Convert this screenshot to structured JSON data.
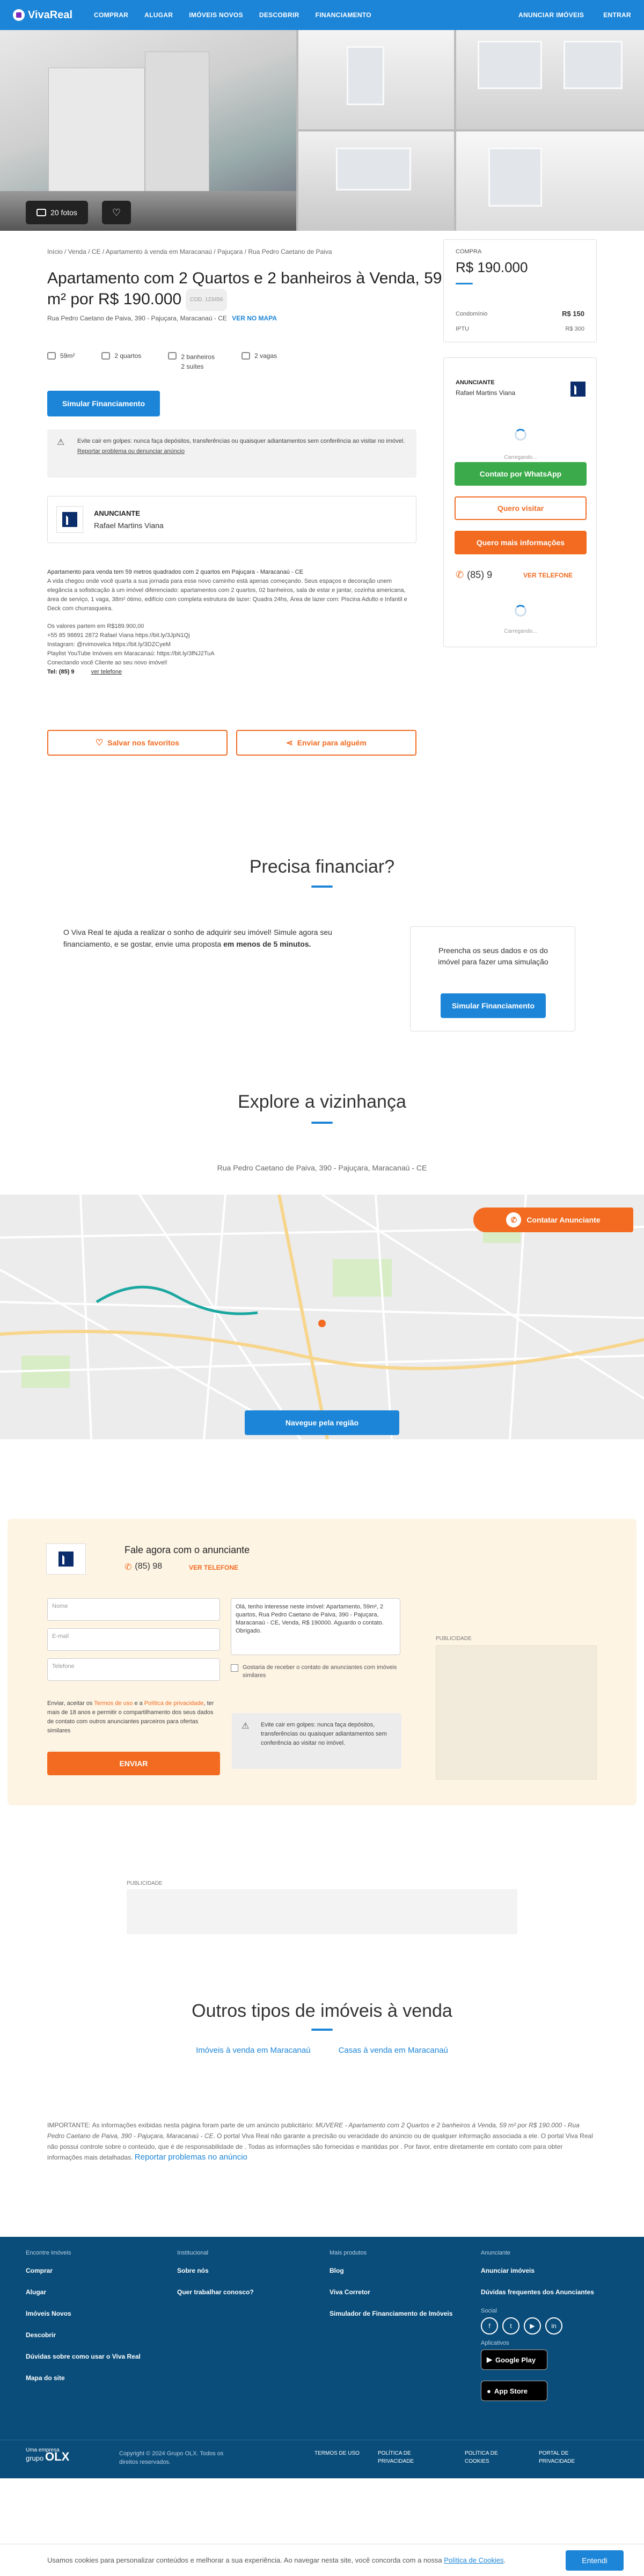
{
  "header": {
    "brand": "VivaReal",
    "nav": [
      "COMPRAR",
      "ALUGAR",
      "IMÓVEIS NOVOS",
      "DESCOBRIR",
      "FINANCIAMENTO"
    ],
    "announce": "ANUNCIAR IMÓVEIS",
    "login": "ENTRAR"
  },
  "gallery": {
    "photos_label": "20 fotos"
  },
  "breadcrumb": [
    "Início",
    "Venda",
    "CE",
    "Apartamento à venda em Maracanaú",
    "Pajuçara",
    "Rua Pedro Caetano de Paiva"
  ],
  "breadcrumb_sep": "/",
  "listing": {
    "title": "Apartamento com 2 Quartos e 2 banheiros à Venda, 59 m² por R$ 190.000",
    "code": "COD. 123456",
    "address": "Rua Pedro Caetano de Paiva, 390 - Pajuçara, Maracanaú - CE",
    "map_link": "VER NO MAPA",
    "area": "59m²",
    "bedrooms": "2 quartos",
    "bathrooms": "2 banheiros",
    "suites": "2 suítes",
    "parking": "2 vagas",
    "simulate_btn": "Simular Financiamento",
    "warning": "Evite cair em golpes: nunca faça depósitos, transferências ou quaisquer adiantamentos sem conferência ao visitar no imóvel.",
    "report_link": "Reportar problema ou denunciar anúncio"
  },
  "advertiser": {
    "label": "ANUNCIANTE",
    "name": "Rafael Martins Viana"
  },
  "description": {
    "heading": "Apartamento para venda tem 59 metros quadrados com 2 quartos em Pajuçara - Maracanaú - CE",
    "body": "A vida chegou onde você quarta a sua jornada para esse novo caminho está apenas começando. Seus espaços e decoração unem elegância a sofisticação à um imóvel diferenciado: apartamentos com 2 quartos, 02 banheiros, sala de estar e jantar, cozinha americana, área de serviço, 1 vaga, 38m² ótimo, edifício com completa estrutura de lazer: Quadra 24hs, Área de lazer com: Piscina Adulto e Infantil e Deck com churrasqueira.",
    "lines": [
      "Os valores partem em R$189.900,00",
      "+55 85 98891 2872 Rafael Viana https://bit.ly/3JpN1Qj",
      "Instagram: @rvimovelca https://bit.ly/3DZCyeM",
      "Playlist YouTube Imóveis em Maracanaú: https://bit.ly/3fNJ2TuA",
      "Conectando você Cliente ao seu novo imóvel!"
    ],
    "phone_label": "Tel: (85) 9",
    "phone_link": "ver telefone"
  },
  "actions": {
    "favorite": "Salvar nos favoritos",
    "share": "Enviar para alguém"
  },
  "price_box": {
    "label": "COMPRA",
    "price": "R$ 190.000",
    "condo_label": "Condomínio",
    "condo_value": "R$ 150",
    "iptu_label": "IPTU",
    "iptu_value": "R$ 300"
  },
  "contact_box": {
    "label": "ANUNCIANTE",
    "name": "Rafael Martins Viana",
    "loading": "Carregando...",
    "whatsapp": "Contato por WhatsApp",
    "visit": "Quero visitar",
    "info": "Quero mais informações",
    "phone": "(85) 9",
    "phone_cta": "VER TELEFONE",
    "loading2": "Carregando..."
  },
  "finance": {
    "heading": "Precisa financiar?",
    "text_a": "O Viva Real te ajuda a realizar o sonho de adquirir seu imóvel! Simule agora seu financiamento, e se gostar, envie uma proposta ",
    "text_b": "em menos de 5 minutos.",
    "card_text": "Preencha os seus dados e os do imóvel para fazer uma simulação",
    "card_btn": "Simular Financiamento"
  },
  "neighborhood": {
    "heading": "Explore a vizinhança",
    "address": "Rua Pedro Caetano de Paiva, 390 - Pajuçara, Maracanaú - CE",
    "contact_btn": "Contatar Anunciante",
    "navigate_btn": "Navegue pela região"
  },
  "contact_form": {
    "heading": "Fale agora com o anunciante",
    "phone": "(85) 98",
    "phone_cta": "VER TELEFONE",
    "name_ph": "Nome",
    "email_ph": "E-mail",
    "phone_ph": "Telefone",
    "message": "Olá, tenho interesse neste imóvel: Apartamento, 59m², 2 quartos, Rua Pedro Caetano de Paiva, 390 - Pajuçara, Maracanaú - CE, Venda, R$ 190000. Aguardo o contato. Obrigado.",
    "similar": "Gostaria de receber o contato de anunciantes com imóveis similares",
    "terms_a": "Enviar, aceitar os ",
    "terms_link1": "Termos de uso",
    "terms_b": " e a ",
    "terms_link2": "Política de privacidade",
    "terms_c": ", ter mais de 18 anos e permitir o compartilhamento dos seus dados de contato com outros anunciantes parceiros para ofertas similares",
    "send": "ENVIAR",
    "warning": "Evite cair em golpes: nunca faça depósitos, transferências ou quaisquer adiantamentos sem conferência ao visitar no imóvel.",
    "ad_label": "PUBLICIDADE"
  },
  "ad2": {
    "label": "PUBLICIDADE"
  },
  "other": {
    "heading": "Outros tipos de imóveis à venda",
    "links": [
      "Imóveis à venda em Maracanaú",
      "Casas à venda em Maracanaú"
    ]
  },
  "disclaimer": {
    "lead": "IMPORTANTE: As informações exibidas nesta página foram parte de um anúncio publicitário: ",
    "title": "MUVERE - Apartamento com 2 Quartos e 2 banheiros à Venda, 59 m² por R$ 190.000 - Rua Pedro Caetano de Paiva, 390 - Pajuçara, Maracanaú - CE",
    "rest": ". O portal Viva Real não garante a precisão ou veracidade do anúncio ou de qualquer informação associada a ele. O portal Viva Real não possui controle sobre o conteúdo, que é de responsabilidade de . Todas as informações são fornecidas e mantidas por . Por favor, entre diretamente em contato com para obter informações mais detalhadas.",
    "link": "Reportar problemas no anúncio"
  },
  "footer": {
    "col1_h": "Encontre imóveis",
    "col1": [
      "Comprar",
      "Alugar",
      "Imóveis Novos",
      "Descobrir",
      "Dúvidas sobre como usar o Viva Real",
      "Mapa do site"
    ],
    "col2_h": "Institucional",
    "col2": [
      "Sobre nós",
      "Quer trabalhar conosco?"
    ],
    "col3_h": "Mais produtos",
    "col3": [
      "Blog",
      "Viva Corretor",
      "Simulador de Financiamento de Imóveis"
    ],
    "col4_h": "Anunciante",
    "col4": [
      "Anunciar imóveis",
      "Dúvidas frequentes dos Anunciantes"
    ],
    "social_h": "Social",
    "apps_h": "Aplicativos",
    "google_play": "Google Play",
    "app_store": "App Store",
    "group_a": "Uma empresa",
    "group_b": "grupo",
    "group_brand": "OLX",
    "copyright": "Copyright © 2024 Grupo OLX. Todos os direitos reservados.",
    "legal": [
      "TERMOS DE USO",
      "POLÍTICA DE PRIVACIDADE",
      "POLÍTICA DE COOKIES",
      "PORTAL DE PRIVACIDADE"
    ]
  },
  "cookie": {
    "text": "Usamos cookies para personalizar conteúdos e melhorar a sua experiência. Ao navegar nesta site, você concorda com a nossa ",
    "link": "Política de Cookies",
    "end": ".",
    "btn": "Entendi"
  },
  "colors": {
    "brand": "#1c85d8",
    "orange": "#f26b21",
    "green": "#3aaa4a",
    "footer": "#0a4d7a"
  }
}
